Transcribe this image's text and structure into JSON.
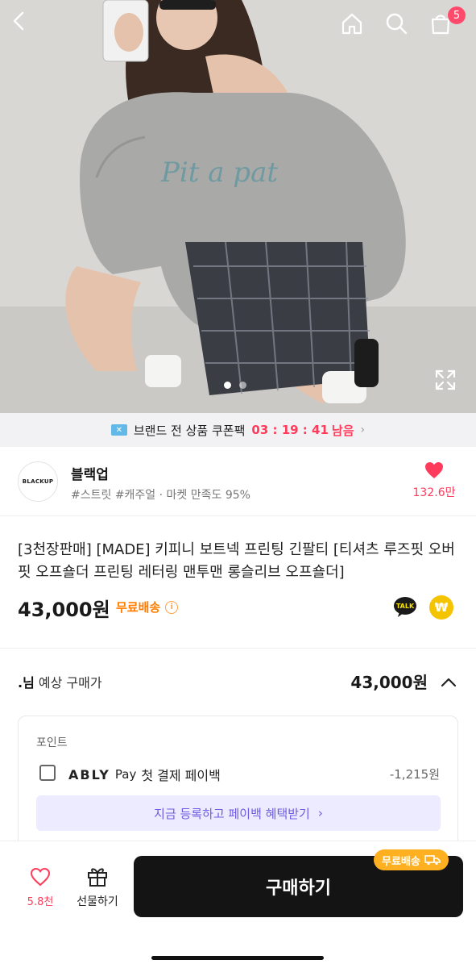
{
  "hero": {
    "badge_count": "5",
    "icons": [
      "back-icon",
      "home-icon",
      "search-icon",
      "shopping-bag-icon",
      "expand-icon"
    ],
    "carousel_total": 2,
    "carousel_active": 1
  },
  "coupon": {
    "label": "브랜드 전 상품 쿠폰팩",
    "countdown": "03 : 19 : 41",
    "suffix": "남음"
  },
  "brand": {
    "logo_text": "BLACKUP",
    "name": "블랙업",
    "meta": "#스트릿 #캐주얼 · 마켓 만족도 95%",
    "like_count": "132.6만"
  },
  "product": {
    "title": "[3천장판매] [MADE] 키피니 보트넥 프린팅 긴팔티 [티셔츠 루즈핏 오버핏 오프숄더 프린팅 레터링 맨투맨 롱슬리브 오프숄더]",
    "price": "43,000원",
    "shipping": "무료배송"
  },
  "estimate": {
    "user": ".님",
    "label": "예상 구매가",
    "price": "43,000원"
  },
  "points": {
    "title": "포인트",
    "pay_brand": "ABLY",
    "pay_word": "Pay",
    "pay_desc": "첫 결제 페이백",
    "amount": "-1,215원",
    "enroll_label": "지금 등록하고 페이백 혜택받기"
  },
  "bottom": {
    "wish_count": "5.8천",
    "gift_label": "선물하기",
    "buy_label": "구매하기",
    "free_badge": "무료배송"
  },
  "colors": {
    "accent_pink": "#ff3b5c",
    "shipping_orange": "#ff7d00",
    "enroll_purple": "#6b5de0",
    "buy_button": "#141414"
  }
}
